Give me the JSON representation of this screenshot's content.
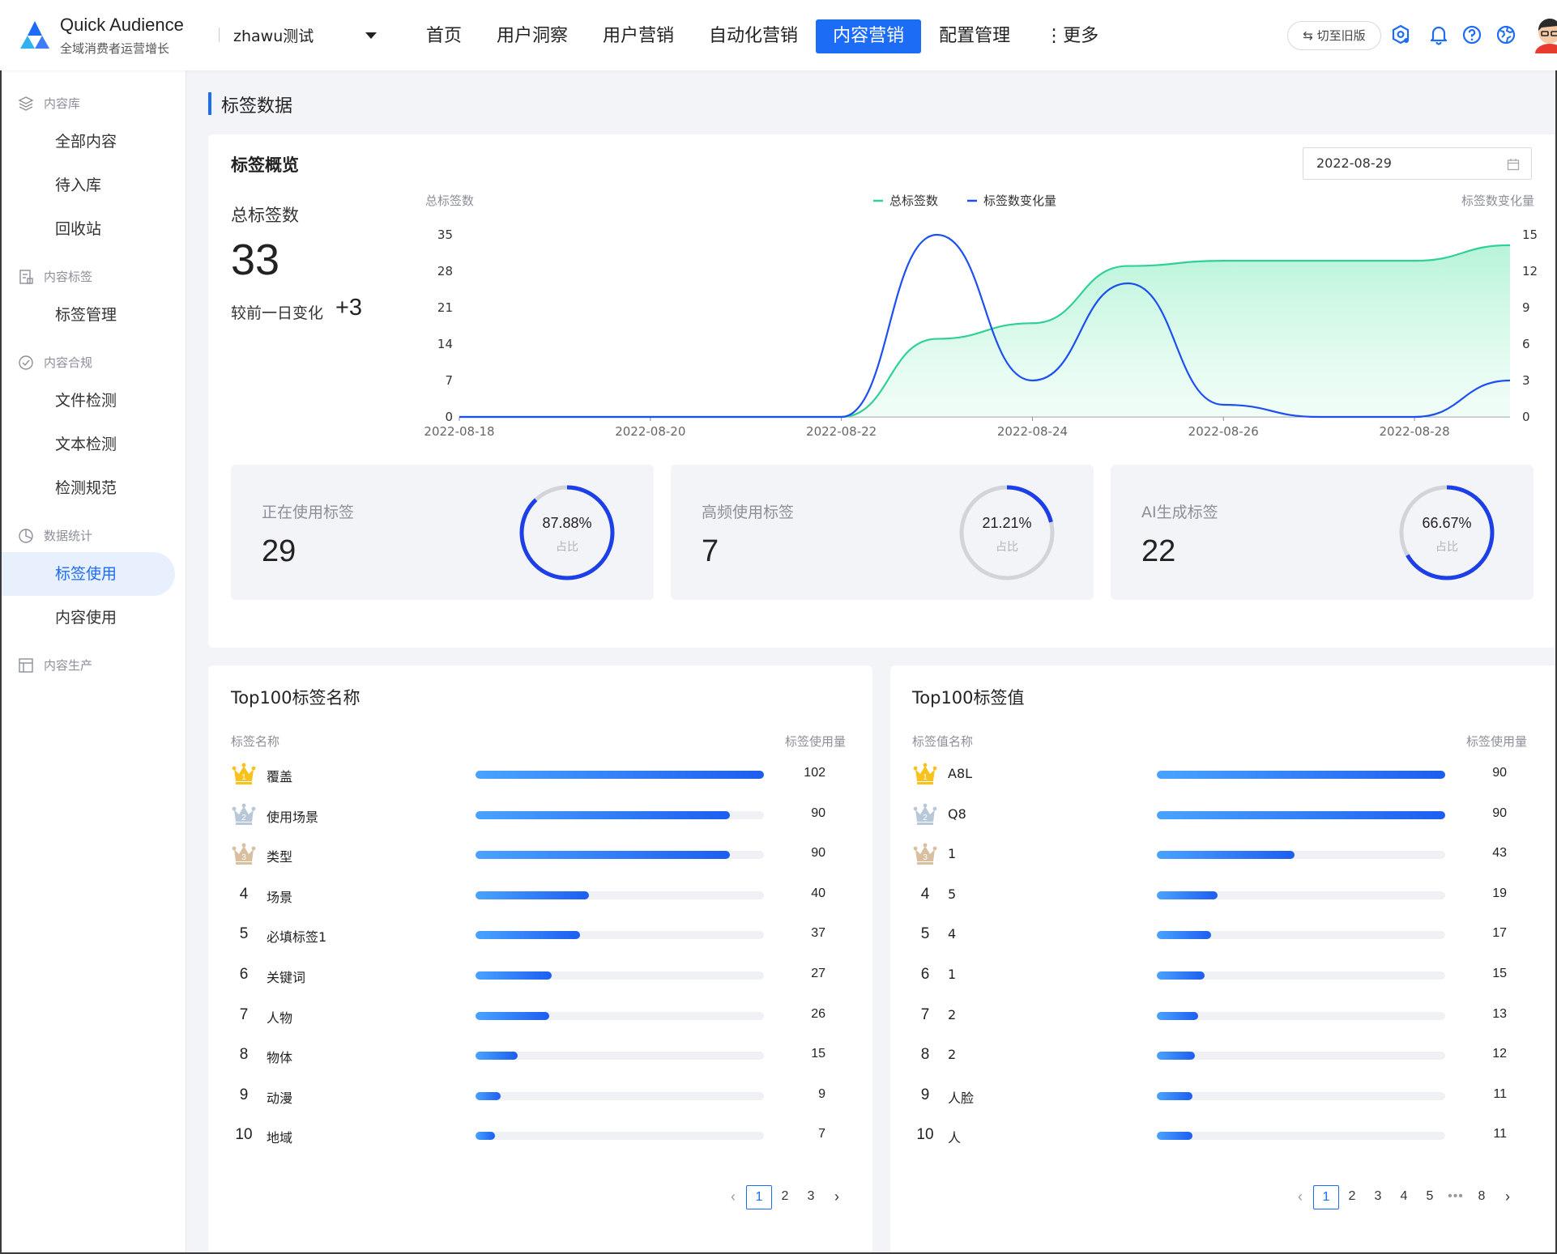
{
  "header": {
    "brand_title": "Quick Audience",
    "brand_sub": "全域消费者运营增长",
    "workspace": "zhawu测试",
    "nav": [
      "首页",
      "用户洞察",
      "用户营销",
      "自动化营销",
      "内容营销",
      "配置管理",
      "⋮更多"
    ],
    "nav_active": "内容营销",
    "switch_label": "⇆ 切至旧版"
  },
  "sidebar": {
    "groups": [
      {
        "label": "内容库",
        "icon": "layers-icon",
        "items": [
          "全部内容",
          "待入库",
          "回收站"
        ]
      },
      {
        "label": "内容标签",
        "icon": "tag-doc-icon",
        "items": [
          "标签管理"
        ]
      },
      {
        "label": "内容合规",
        "icon": "compliance-icon",
        "items": [
          "文件检测",
          "文本检测",
          "检测规范"
        ]
      },
      {
        "label": "数据统计",
        "icon": "pie-chart-icon",
        "items": [
          "标签使用",
          "内容使用"
        ]
      },
      {
        "label": "内容生产",
        "icon": "layout-icon",
        "items": []
      }
    ],
    "active_item": "标签使用"
  },
  "page": {
    "title": "标签数据"
  },
  "overview": {
    "title": "标签概览",
    "date": "2022-08-29",
    "total_label": "总标签数",
    "total_value": "33",
    "delta_label": "较前一日变化",
    "delta_value": "+3"
  },
  "chart_data": {
    "type": "line",
    "x": [
      "2022-08-18",
      "2022-08-19",
      "2022-08-20",
      "2022-08-21",
      "2022-08-22",
      "2022-08-23",
      "2022-08-24",
      "2022-08-25",
      "2022-08-26",
      "2022-08-27",
      "2022-08-28",
      "2022-08-29"
    ],
    "x_tick_labels": [
      "2022-08-18",
      "2022-08-20",
      "2022-08-22",
      "2022-08-24",
      "2022-08-26",
      "2022-08-28"
    ],
    "series": [
      {
        "name": "总标签数",
        "axis": "left",
        "type": "area",
        "color": "#2fd196",
        "values": [
          0,
          0,
          0,
          0,
          0,
          15,
          18,
          29,
          30,
          30,
          30,
          33
        ]
      },
      {
        "name": "标签数变化量",
        "axis": "right",
        "type": "line",
        "color": "#1d4ff0",
        "values": [
          0,
          0,
          0,
          0,
          0,
          15,
          3,
          11,
          1,
          0,
          0,
          3
        ]
      }
    ],
    "ylabel_left": "总标签数",
    "ylabel_right": "标签数变化量",
    "ylim_left": [
      0,
      35
    ],
    "ylim_right": [
      0,
      15
    ],
    "yticks_left": [
      0,
      7,
      14,
      21,
      28,
      35
    ],
    "yticks_right": [
      0,
      3,
      6,
      9,
      12,
      15
    ],
    "legend_position": "top-center",
    "grid": false
  },
  "stats": [
    {
      "label": "正在使用标签",
      "value": "29",
      "percent": "87.88%",
      "fraction": 0.8788,
      "sub": "占比"
    },
    {
      "label": "高频使用标签",
      "value": "7",
      "percent": "21.21%",
      "fraction": 0.2121,
      "sub": "占比"
    },
    {
      "label": "AI生成标签",
      "value": "22",
      "percent": "66.67%",
      "fraction": 0.6667,
      "sub": "占比"
    }
  ],
  "colors": {
    "accent": "#1d6cf5",
    "ring": "#1d3fe8",
    "gold": "#f6c21b",
    "silver": "#b9c8d8",
    "bronze": "#d9bf9f"
  },
  "top_names": {
    "title": "Top100标签名称",
    "col_name": "标签名称",
    "col_usage": "标签使用量",
    "max": 102,
    "rows": [
      {
        "rank": "1",
        "name": "覆盖",
        "value": 102
      },
      {
        "rank": "2",
        "name": "使用场景",
        "value": 90
      },
      {
        "rank": "3",
        "name": "类型",
        "value": 90
      },
      {
        "rank": "4",
        "name": "场景",
        "value": 40
      },
      {
        "rank": "5",
        "name": "必填标签1",
        "value": 37
      },
      {
        "rank": "6",
        "name": "关键词",
        "value": 27
      },
      {
        "rank": "7",
        "name": "人物",
        "value": 26
      },
      {
        "rank": "8",
        "name": "物体",
        "value": 15
      },
      {
        "rank": "9",
        "name": "动漫",
        "value": 9
      },
      {
        "rank": "10",
        "name": "地域",
        "value": 7
      }
    ],
    "pages": [
      "1",
      "2",
      "3"
    ],
    "current_page": "1"
  },
  "top_values": {
    "title": "Top100标签值",
    "col_name": "标签值名称",
    "col_usage": "标签使用量",
    "max": 90,
    "rows": [
      {
        "rank": "1",
        "name": "A8L",
        "value": 90
      },
      {
        "rank": "2",
        "name": "Q8",
        "value": 90
      },
      {
        "rank": "3",
        "name": "1",
        "value": 43
      },
      {
        "rank": "4",
        "name": "5",
        "value": 19
      },
      {
        "rank": "5",
        "name": "4",
        "value": 17
      },
      {
        "rank": "6",
        "name": "1",
        "value": 15
      },
      {
        "rank": "7",
        "name": "2",
        "value": 13
      },
      {
        "rank": "8",
        "name": "2",
        "value": 12
      },
      {
        "rank": "9",
        "name": "人脸",
        "value": 11
      },
      {
        "rank": "10",
        "name": "人",
        "value": 11
      }
    ],
    "pages": [
      "1",
      "2",
      "3",
      "4",
      "5",
      "•••",
      "8"
    ],
    "current_page": "1"
  }
}
